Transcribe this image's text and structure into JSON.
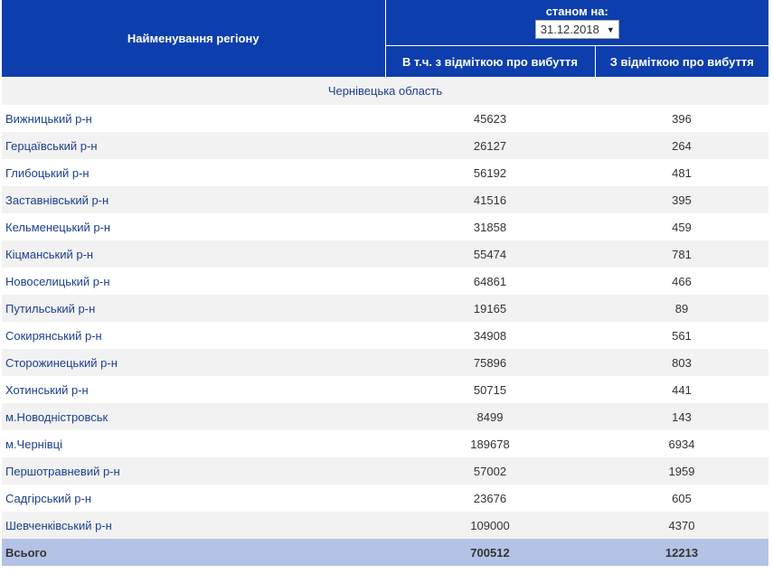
{
  "header": {
    "region_col": "Найменування регіону",
    "date_label": "станом на:",
    "date_value": "31.12.2018",
    "col_left": "В т.ч. з відміткою про вибуття",
    "col_right": "З відміткою про вибуття"
  },
  "oblast": "Чернівецька область",
  "rows": [
    {
      "name": "Вижницький р-н",
      "a": "45623",
      "b": "396"
    },
    {
      "name": "Герцаївський р-н",
      "a": "26127",
      "b": "264"
    },
    {
      "name": "Глибоцький р-н",
      "a": "56192",
      "b": "481"
    },
    {
      "name": "Заставнівський р-н",
      "a": "41516",
      "b": "395"
    },
    {
      "name": "Кельменецький р-н",
      "a": "31858",
      "b": "459"
    },
    {
      "name": "Кіцманський р-н",
      "a": "55474",
      "b": "781"
    },
    {
      "name": "Новоселицький р-н",
      "a": "64861",
      "b": "466"
    },
    {
      "name": "Путильський р-н",
      "a": "19165",
      "b": "89"
    },
    {
      "name": "Сокирянський р-н",
      "a": "34908",
      "b": "561"
    },
    {
      "name": "Сторожинецький р-н",
      "a": "75896",
      "b": "803"
    },
    {
      "name": "Хотинський р-н",
      "a": "50715",
      "b": "441"
    },
    {
      "name": "м.Новодністровськ",
      "a": "8499",
      "b": "143"
    },
    {
      "name": "м.Чернівці",
      "a": "189678",
      "b": "6934"
    },
    {
      "name": "Першотравневий р-н",
      "a": "57002",
      "b": "1959"
    },
    {
      "name": "Садгірський р-н",
      "a": "23676",
      "b": "605"
    },
    {
      "name": "Шевченківський р-н",
      "a": "109000",
      "b": "4370"
    }
  ],
  "total": {
    "name": "Всього",
    "a": "700512",
    "b": "12213"
  },
  "colors": {
    "header_bg": "#0c3fad",
    "link": "#1d3f8f",
    "stripe": "#f2f2f2",
    "total_bg": "#b4c2e6"
  }
}
